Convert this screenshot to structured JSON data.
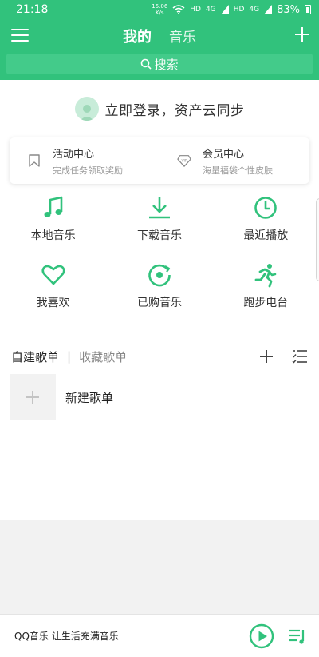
{
  "status": {
    "time": "21:18",
    "speed_value": "15.06",
    "speed_unit": "K/s",
    "hd1": "HD",
    "sig1": "4G",
    "hd2": "HD",
    "sig2": "4G",
    "battery": "83%"
  },
  "header": {
    "tabs": [
      {
        "label": "我的",
        "active": true
      },
      {
        "label": "音乐",
        "active": false
      }
    ],
    "search_label": "搜索"
  },
  "login": {
    "text": "立即登录，资产云同步"
  },
  "promo": [
    {
      "title": "活动中心",
      "subtitle": "完成任务领取奖励",
      "icon": "bookmark-icon"
    },
    {
      "title": "会员中心",
      "subtitle": "海量福袋个性皮肤",
      "icon": "vip-diamond-icon"
    }
  ],
  "grid": [
    {
      "label": "本地音乐",
      "icon": "music-note-icon"
    },
    {
      "label": "下载音乐",
      "icon": "download-icon"
    },
    {
      "label": "最近播放",
      "icon": "clock-icon"
    },
    {
      "label": "我喜欢",
      "icon": "heart-icon"
    },
    {
      "label": "已购音乐",
      "icon": "purchased-disc-icon"
    },
    {
      "label": "跑步电台",
      "icon": "running-icon"
    }
  ],
  "playlists": {
    "tab_created": "自建歌单",
    "separator": "|",
    "tab_collected": "收藏歌单",
    "new_label": "新建歌单"
  },
  "player": {
    "text": "QQ音乐 让生活充满音乐"
  },
  "colors": {
    "accent": "#31c27c"
  }
}
